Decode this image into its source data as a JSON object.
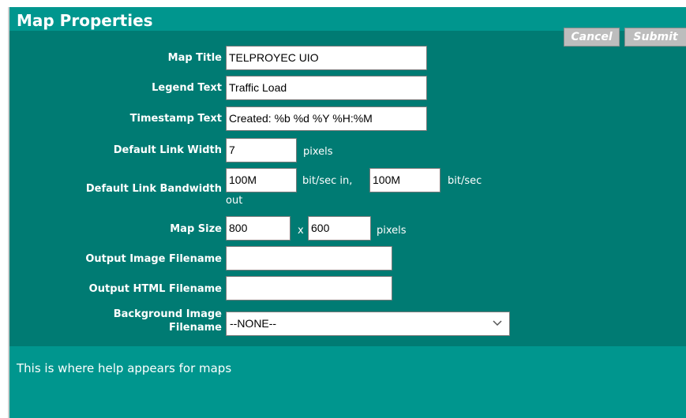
{
  "dialog": {
    "title": "Map Properties",
    "cancel_label": "Cancel",
    "submit_label": "Submit"
  },
  "fields": {
    "map_title": {
      "label": "Map Title",
      "value": "TELPROYEC UIO"
    },
    "legend_text": {
      "label": "Legend Text",
      "value": "Traffic Load"
    },
    "timestamp_text": {
      "label": "Timestamp Text",
      "value": "Created: %b %d %Y %H:%M"
    },
    "default_link_width": {
      "label": "Default Link Width",
      "value": "7",
      "unit": "pixels"
    },
    "default_link_bandwidth": {
      "label": "Default Link Bandwidth",
      "value_in": "100M",
      "unit_in": "bit/sec in,",
      "value_out": "100M",
      "unit_out_line1": "bit/sec",
      "unit_out_line2": "out"
    },
    "map_size": {
      "label": "Map Size",
      "width": "800",
      "separator": "x",
      "height": "600",
      "unit": "pixels"
    },
    "output_image_filename": {
      "label": "Output Image Filename",
      "value": ""
    },
    "output_html_filename": {
      "label": "Output HTML Filename",
      "value": ""
    },
    "background_image_filename": {
      "label_line1": "Background Image",
      "label_line2": "Filename",
      "selected": "--NONE--"
    }
  },
  "help": {
    "text": "This is where help appears for maps"
  },
  "colors": {
    "dialog_bg": "#007b73",
    "title_bar_bg": "#00968e",
    "help_bg": "#00968e",
    "button_bg": "#bdbdbd",
    "text": "#ffffff"
  },
  "icons": {
    "select_arrow": "chevron-down-icon"
  }
}
